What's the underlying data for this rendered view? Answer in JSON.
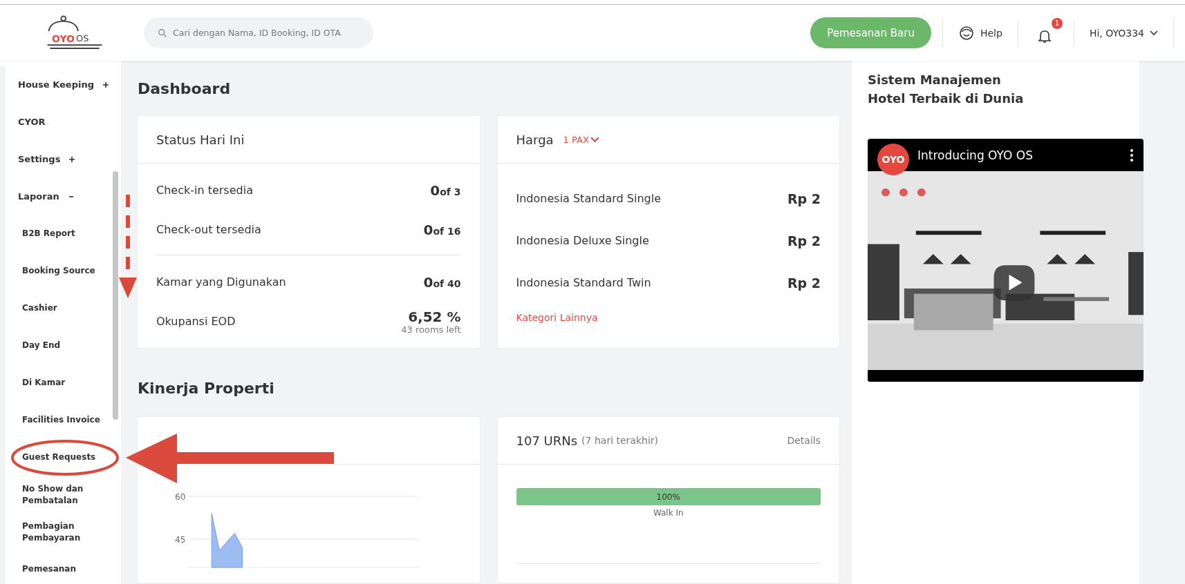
{
  "header": {
    "logo": {
      "brand": "OYO",
      "suffix": "OS"
    },
    "search": {
      "placeholder": "Cari dengan Nama, ID Booking, ID OTA"
    },
    "new_booking_button": "Pemesanan Baru",
    "help": "Help",
    "notifications": {
      "count": "1"
    },
    "user_menu": "Hi, OYO334"
  },
  "sidebar": {
    "items": [
      {
        "label": "House Keeping",
        "expanded": false
      },
      {
        "label": "CYOR"
      },
      {
        "label": "Settings",
        "expanded": false
      },
      {
        "label": "Laporan",
        "expanded": true,
        "children": [
          {
            "label": "B2B Report",
            "circled": false
          },
          {
            "label": "Booking Source",
            "circled": false
          },
          {
            "label": "Cashier",
            "circled": false
          },
          {
            "label": "Day End",
            "circled": false
          },
          {
            "label": "Di Kamar",
            "circled": false
          },
          {
            "label": "Facilities Invoice",
            "circled": false
          },
          {
            "label": "Guest Requests",
            "circled": true
          },
          {
            "label": "No Show dan Pembatalan",
            "circled": false
          },
          {
            "label": "Pembagian Pembayaran",
            "circled": false
          },
          {
            "label": "Pemesanan",
            "circled": false
          }
        ]
      }
    ]
  },
  "dashboard": {
    "title": "Dashboard",
    "status_card": {
      "title": "Status Hari Ini",
      "groups": [
        [
          {
            "label": "Check-in tersedia",
            "value": "0",
            "of": "of 3"
          },
          {
            "label": "Check-out tersedia",
            "value": "0",
            "of": "of 16"
          }
        ],
        [
          {
            "label": "Kamar yang Digunakan",
            "value": "0",
            "of": "of 40"
          },
          {
            "label": "Okupansi EOD",
            "value": "6,52 %",
            "note": "43 rooms left"
          }
        ]
      ]
    },
    "price_card": {
      "title": "Harga",
      "pax": "1 PAX",
      "rows": [
        {
          "label": "Indonesia Standard Single",
          "price": "Rp 2"
        },
        {
          "label": "Indonesia Deluxe Single",
          "price": "Rp 2"
        },
        {
          "label": "Indonesia Standard Twin",
          "price": "Rp 2"
        }
      ],
      "link": "Kategori Lainnya"
    }
  },
  "performance": {
    "title": "Kinerja Properti",
    "occupancy_card": {
      "chart_data": {
        "type": "area",
        "categories": [
          null,
          null,
          null,
          null,
          null,
          null,
          null,
          null,
          null,
          null,
          null,
          null,
          null,
          null,
          null,
          null,
          null,
          null,
          null,
          null,
          null,
          null,
          null,
          null,
          null,
          null,
          null,
          null,
          null,
          null,
          null
        ],
        "ylim": [
          35,
          60
        ],
        "yticks": [
          45,
          60
        ],
        "values": [
          null,
          null,
          null,
          54,
          41,
          44,
          47,
          42,
          null,
          null,
          null,
          null,
          null,
          null,
          null,
          null,
          null,
          null,
          null,
          null,
          null,
          null,
          null,
          null,
          null,
          null,
          null,
          null,
          null,
          null,
          null
        ]
      }
    },
    "urn_card": {
      "title": "107 URNs",
      "subtitle": "(7 hari terakhir)",
      "link": "Details",
      "bar": {
        "level": 1,
        "label": "100%",
        "caption": "Walk In"
      }
    }
  },
  "promo": {
    "heading": "Sistem Manajemen Hotel Terbaik di Dunia",
    "video": {
      "kind": "picture",
      "channel_logo": "OYO",
      "title": "Introducing OYO OS"
    }
  }
}
